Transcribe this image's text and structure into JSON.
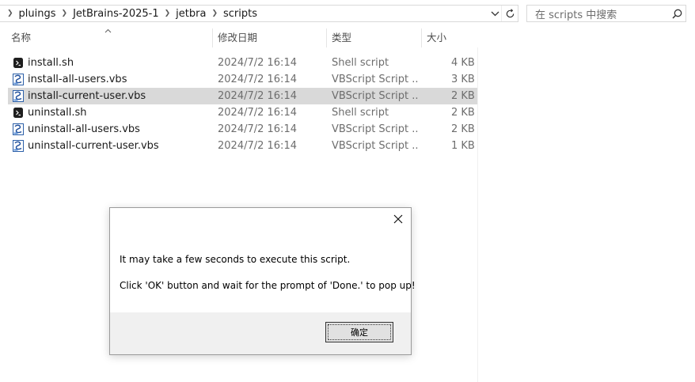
{
  "breadcrumb": [
    "pluings",
    "JetBrains-2025-1",
    "jetbra",
    "scripts"
  ],
  "search": {
    "placeholder": "在 scripts 中搜索"
  },
  "columns": {
    "name": "名称",
    "date": "修改日期",
    "type": "类型",
    "size": "大小"
  },
  "files": [
    {
      "name": "install.sh",
      "date": "2024/7/2 16:14",
      "type": "Shell script",
      "size": "4 KB",
      "icon": "shell-script-icon",
      "selected": false
    },
    {
      "name": "install-all-users.vbs",
      "date": "2024/7/2 16:14",
      "type": "VBScript Script ...",
      "size": "3 KB",
      "icon": "vbscript-icon",
      "selected": false
    },
    {
      "name": "install-current-user.vbs",
      "date": "2024/7/2 16:14",
      "type": "VBScript Script ...",
      "size": "2 KB",
      "icon": "vbscript-icon",
      "selected": true
    },
    {
      "name": "uninstall.sh",
      "date": "2024/7/2 16:14",
      "type": "Shell script",
      "size": "2 KB",
      "icon": "shell-script-icon",
      "selected": false
    },
    {
      "name": "uninstall-all-users.vbs",
      "date": "2024/7/2 16:14",
      "type": "VBScript Script ...",
      "size": "2 KB",
      "icon": "vbscript-icon",
      "selected": false
    },
    {
      "name": "uninstall-current-user.vbs",
      "date": "2024/7/2 16:14",
      "type": "VBScript Script ...",
      "size": "1 KB",
      "icon": "vbscript-icon",
      "selected": false
    }
  ],
  "dialog": {
    "message_line1": "It may take a few seconds to execute this script.",
    "message_line2": "Click 'OK' button and wait for the prompt of 'Done.' to pop up!",
    "ok_label": "确定"
  },
  "colors": {
    "selection": "#d9d9d9",
    "dialog_footer": "#f0f0f0",
    "secondary_text": "#6d6d6d"
  }
}
